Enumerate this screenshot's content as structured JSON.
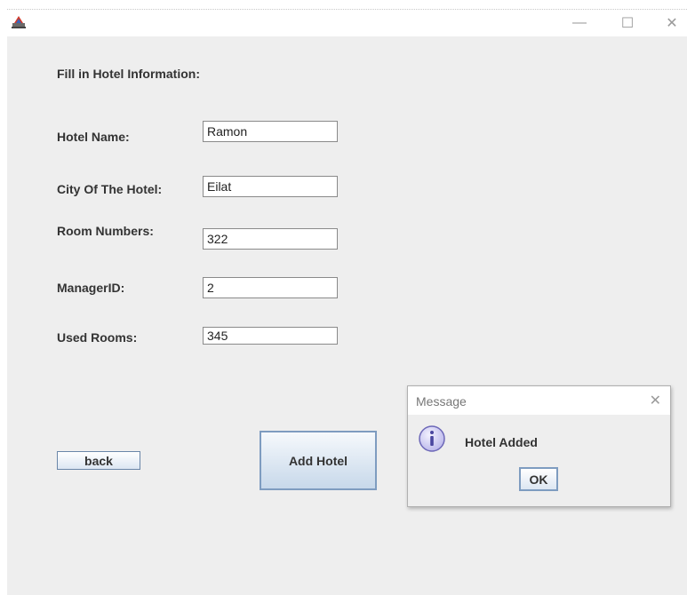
{
  "window": {
    "title": "",
    "controls": {
      "minimize": "—",
      "maximize": "☐",
      "close": "✕"
    }
  },
  "form": {
    "heading": "Fill in Hotel Information:",
    "fields": [
      {
        "label": "Hotel Name:",
        "value": "Ramon"
      },
      {
        "label": "City Of The Hotel:",
        "value": "Eilat"
      },
      {
        "label": "Room Numbers:",
        "value": "322"
      },
      {
        "label": "ManagerID:",
        "value": "2"
      },
      {
        "label": "Used Rooms:",
        "value": "345"
      }
    ],
    "back_label": "back",
    "add_label": "Add Hotel"
  },
  "dialog": {
    "title": "Message",
    "close_glyph": "✕",
    "icon": "info-icon",
    "message": "Hotel Added",
    "ok_label": "OK"
  },
  "colors": {
    "background": "#eeeeee",
    "button_border": "#7e9cc0",
    "info_icon_fill": "#c9c6ef"
  }
}
